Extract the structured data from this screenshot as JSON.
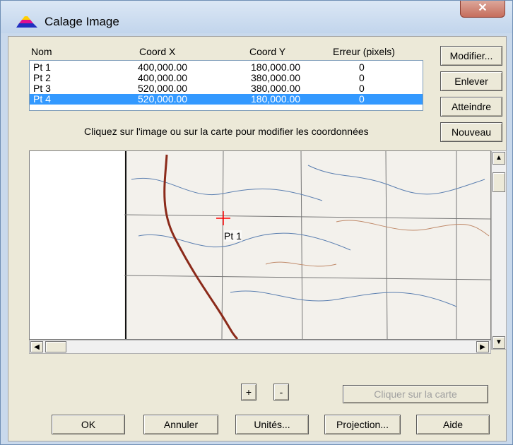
{
  "window": {
    "title": "Calage Image",
    "close_glyph": "✕"
  },
  "table": {
    "headers": [
      "Nom",
      "Coord X",
      "Coord Y",
      "Erreur (pixels)"
    ],
    "rows": [
      {
        "nom": "Pt 1",
        "x": "400,000.00",
        "y": "180,000.00",
        "err": "0"
      },
      {
        "nom": "Pt 2",
        "x": "400,000.00",
        "y": "380,000.00",
        "err": "0"
      },
      {
        "nom": "Pt 3",
        "x": "520,000.00",
        "y": "380,000.00",
        "err": "0"
      },
      {
        "nom": "Pt 4",
        "x": "520,000.00",
        "y": "180,000.00",
        "err": "0"
      }
    ],
    "selected_index": 3
  },
  "side_buttons": {
    "modifier": "Modifier...",
    "enlever": "Enlever",
    "atteindre": "Atteindre",
    "nouveau": "Nouveau"
  },
  "hint": "Cliquez sur l'image ou sur la carte pour modifier les coordonnées",
  "map": {
    "point_label": "Pt 1"
  },
  "zoom": {
    "plus": "+",
    "minus": "-"
  },
  "cliquer_carte": "Cliquer sur la carte",
  "bottom_buttons": {
    "ok": "OK",
    "annuler": "Annuler",
    "unites": "Unités...",
    "projection": "Projection...",
    "aide": "Aide"
  },
  "colors": {
    "selection": "#3399ff",
    "title_bg": "#c9d9ec",
    "dialog_bg": "#ece9d8",
    "marker": "#ff0000",
    "road": "#8b2a1a"
  },
  "icons": {
    "app": "map-layers-icon",
    "close": "close-icon"
  }
}
